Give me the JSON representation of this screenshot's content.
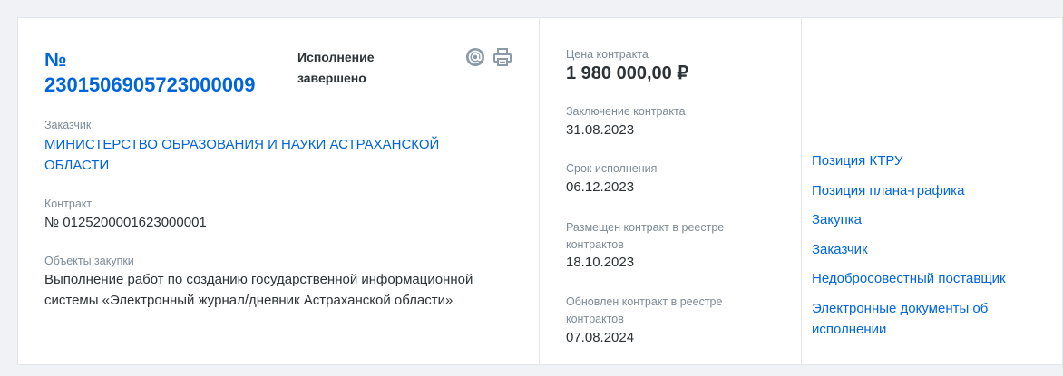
{
  "header": {
    "reg_number_prefix": "№",
    "reg_number": "2301506905723000009",
    "status": "Исполнение завершено"
  },
  "icons": {
    "email": "at-sign-icon",
    "print": "printer-icon"
  },
  "customer": {
    "label": "Заказчик",
    "value": "МИНИСТЕРСТВО ОБРАЗОВАНИЯ И НАУКИ АСТРАХАНСКОЙ ОБЛАСТИ"
  },
  "contract": {
    "label": "Контракт",
    "value": "№ 0125200001623000001"
  },
  "purchase_objects": {
    "label": "Объекты закупки",
    "value": "Выполнение работ по созданию государственной информационной системы «Электронный журнал/дневник Астраханской области»"
  },
  "price": {
    "label": "Цена контракта",
    "value": "1 980 000,00 ₽"
  },
  "dates": [
    {
      "label": "Заключение контракта",
      "value": "31.08.2023"
    },
    {
      "label": "Срок исполнения",
      "value": "06.12.2023"
    },
    {
      "label": "Размещен контракт в реестре контрактов",
      "value": "18.10.2023"
    },
    {
      "label": "Обновлен контракт в реестре контрактов",
      "value": "07.08.2024"
    }
  ],
  "links": [
    "Позиция КТРУ",
    "Позиция плана-графика",
    "Закупка",
    "Заказчик",
    "Недобросовестный поставщик",
    "Электронные документы об исполнении"
  ],
  "colors": {
    "accent": "#0065dd",
    "text": "#2c3236",
    "muted": "#7e8a97",
    "icon": "#8a9aa8",
    "background": "#f1f2f6"
  }
}
